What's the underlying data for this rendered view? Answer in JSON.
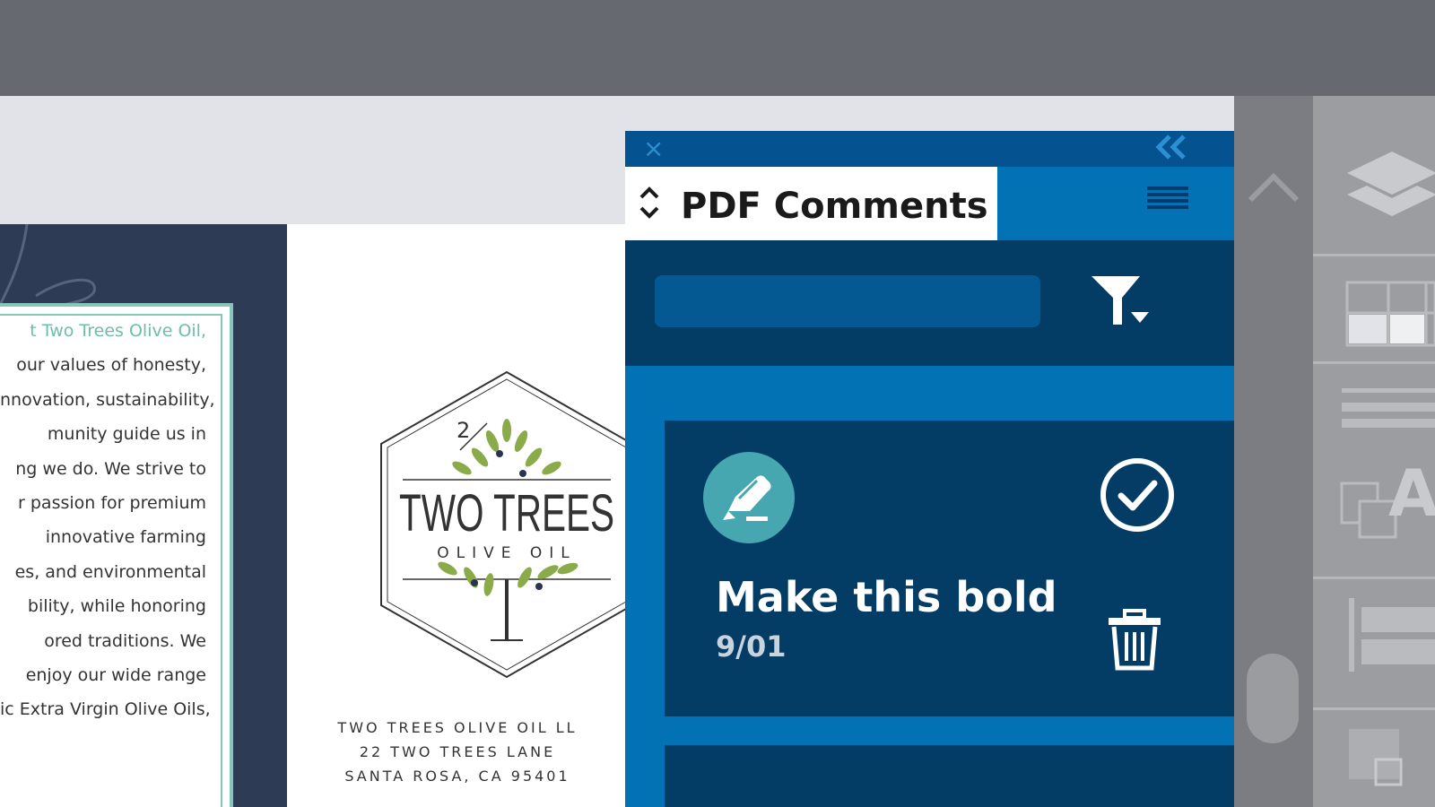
{
  "panel": {
    "title": "PDF Comments",
    "search": {
      "value": "",
      "placeholder": ""
    },
    "comment": {
      "text": "Make this bold",
      "date": "9/01"
    }
  },
  "brochure": {
    "lines": [
      "t Two Trees Olive Oil,",
      "our values of honesty,",
      "nnovation, sustainability,",
      "munity guide us in",
      "ng we do. We strive to",
      "r passion for premium",
      "innovative farming",
      "es, and environmental",
      "bility, while honoring",
      "ored traditions. We",
      " enjoy our wide range",
      "ic Extra Virgin Olive Oils,"
    ],
    "logo": {
      "number": "2",
      "brand": "TWO TREES",
      "sub": "OLIVE OIL"
    },
    "address": [
      "TWO TREES OLIVE OIL LL",
      "22 TWO TREES LANE",
      "SANTA ROSA, CA 95401"
    ]
  },
  "colors": {
    "panel_dark": "#033d66",
    "panel_blue": "#0272b4",
    "accent_teal": "#46a7b1",
    "brochure_navy": "#2d3b55",
    "brochure_mint": "#86c6b6"
  },
  "icons": {
    "close": "×",
    "collapse": "«"
  }
}
